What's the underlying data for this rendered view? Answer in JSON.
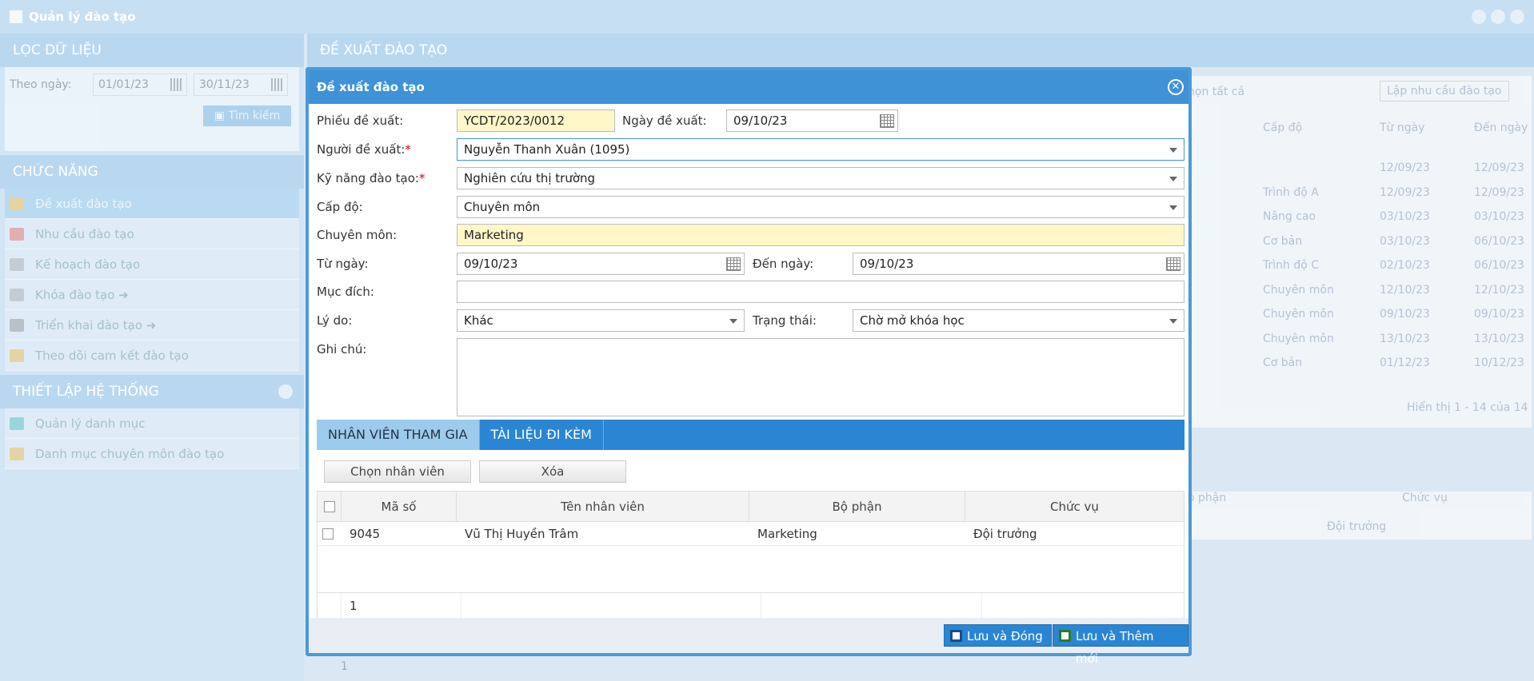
{
  "window": {
    "title": "Quản lý đào tạo"
  },
  "left": {
    "filter": {
      "header": "LỌC DỮ LIỆU",
      "date_label": "Theo ngày:",
      "from": "01/01/23",
      "to": "30/11/23",
      "search_label": "Tìm kiếm"
    },
    "functions": {
      "header": "CHỨC NĂNG",
      "items": [
        "Đề xuất đào tạo",
        "Nhu cầu đào tạo",
        "Kế hoạch đào tạo",
        "Khóa đào tạo ➜",
        "Triển khai đào tạo ➜",
        "Theo dõi cam kết đào tạo"
      ]
    },
    "settings": {
      "header": "THIẾT LẬP HỆ THỐNG",
      "items": [
        "Quản lý danh mục",
        "Danh mục chuyên môn đào tạo"
      ]
    }
  },
  "background": {
    "header": "ĐỀ XUẤT ĐÀO TẠO",
    "select_all": "họn tất cả",
    "needs_button": "Lập nhu cầu đào tạo",
    "columns": [
      "Cấp độ",
      "Từ ngày",
      "Đến ngày"
    ],
    "rows": [
      [
        "",
        "12/09/23",
        "12/09/23"
      ],
      [
        "Trình độ A",
        "12/09/23",
        "12/09/23"
      ],
      [
        "Nâng cao",
        "03/10/23",
        "03/10/23"
      ],
      [
        "Cơ bản",
        "03/10/23",
        "06/10/23"
      ],
      [
        "Trình độ C",
        "02/10/23",
        "06/10/23"
      ],
      [
        "Chuyên môn",
        "12/10/23",
        "12/10/23"
      ],
      [
        "Chuyên môn",
        "09/10/23",
        "09/10/23"
      ],
      [
        "Chuyên môn",
        "13/10/23",
        "13/10/23"
      ],
      [
        "Cơ bản",
        "01/12/23",
        "10/12/23"
      ]
    ],
    "paging": "Hiển thị 1 - 14 của 14",
    "lower_columns": [
      "ộ phận",
      "Chức vụ"
    ],
    "lower_row": "Đội trưởng",
    "bottom_page": "1"
  },
  "modal": {
    "title": "Đề xuất đào tạo",
    "form": {
      "ticket_label": "Phiếu đề xuất:",
      "ticket": "YCDT/2023/0012",
      "date_label": "Ngày đề xuất:",
      "date": "09/10/23",
      "proposer_label": "Người đề xuất:",
      "proposer": "Nguyễn Thanh Xuân (1095)",
      "skill_label": "Kỹ năng đào tạo:",
      "skill": "Nghiên cứu thị trường",
      "level_label": "Cấp độ:",
      "level": "Chuyên môn",
      "specialty_label": "Chuyên môn:",
      "specialty": "Marketing",
      "from_label": "Từ ngày:",
      "from": "09/10/23",
      "to_label": "Đến ngày:",
      "to": "09/10/23",
      "purpose_label": "Mục đích:",
      "purpose": "",
      "reason_label": "Lý do:",
      "reason": "Khác",
      "status_label": "Trạng thái:",
      "status": "Chờ mở khóa học",
      "note_label": "Ghi chú:",
      "note": "",
      "required_mark": "*"
    },
    "tabs": [
      "NHÂN VIÊN THAM GIA",
      "TÀI LIỆU ĐI KÈM"
    ],
    "buttons": {
      "choose": "Chọn nhân viên",
      "delete": "Xóa",
      "save_close": "Lưu và Đóng",
      "save_new": "Lưu và Thêm mới"
    },
    "grid": {
      "columns": [
        "Mã số",
        "Tên nhân viên",
        "Bộ phận",
        "Chức vụ"
      ],
      "rows": [
        {
          "code": "9045",
          "name": "Vũ Thị Huyền Trâm",
          "dept": "Marketing",
          "position": "Đội trưởng"
        }
      ],
      "footer_count": "1"
    }
  }
}
